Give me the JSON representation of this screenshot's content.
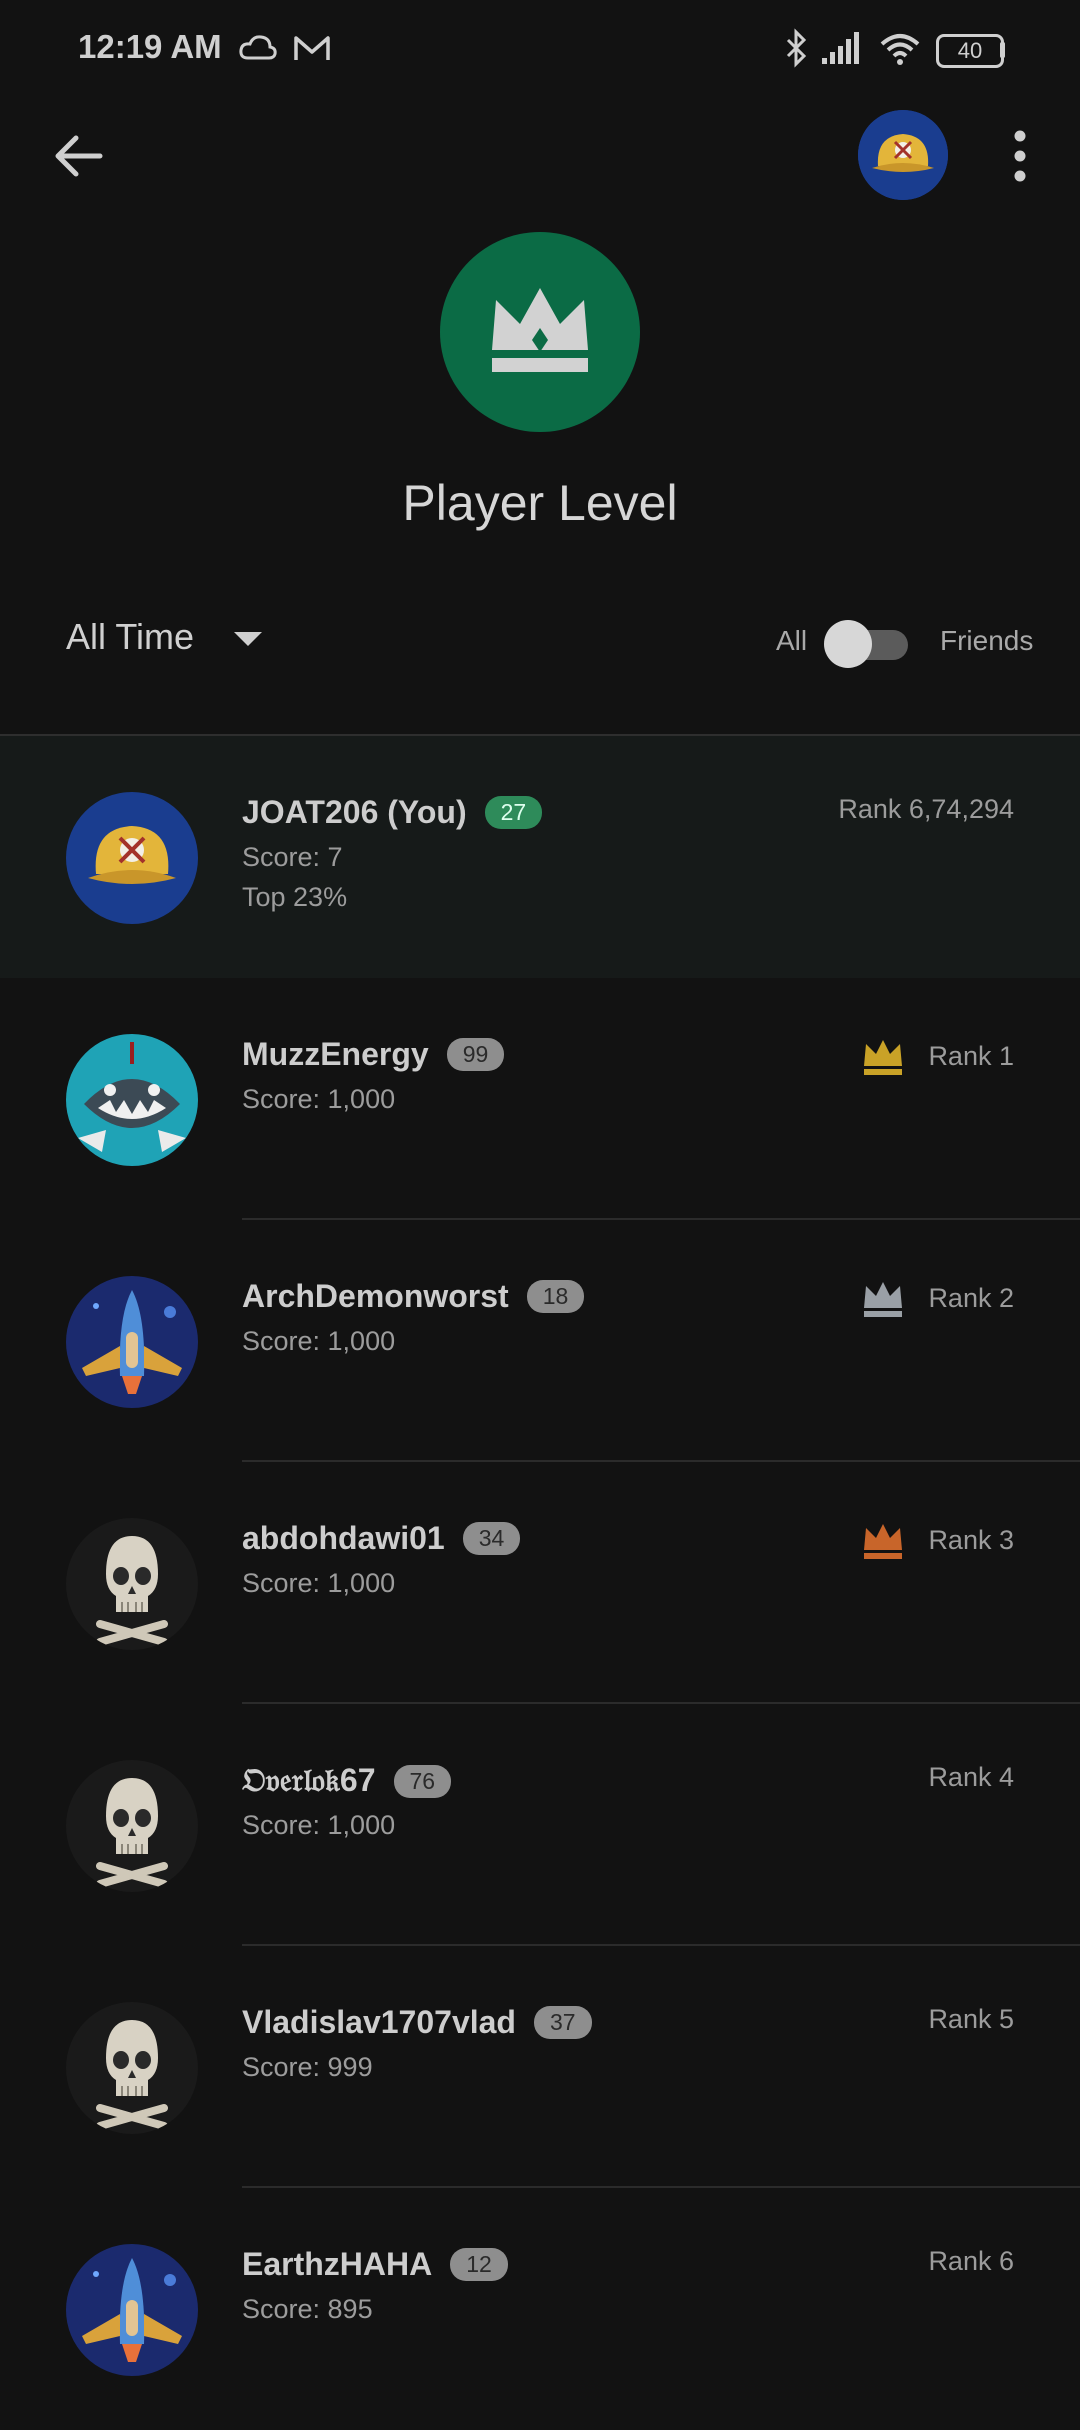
{
  "status_bar": {
    "time": "12:19 AM",
    "battery": "40"
  },
  "header": {
    "title": "Player Level"
  },
  "filters": {
    "time_range": "All Time",
    "toggle_left": "All",
    "toggle_right": "Friends"
  },
  "colors": {
    "background": "#121212",
    "accent_green": "#0b6b45",
    "gold": "#c9a227",
    "silver": "#9aa0a6",
    "bronze": "#c8652a"
  },
  "players": [
    {
      "name": "JOAT206 (You)",
      "level": "27",
      "score": "Score: 7",
      "top": "Top 23%",
      "rank": "Rank 6,74,294",
      "avatar": "baseball-cap",
      "crown": ""
    },
    {
      "name": "MuzzEnergy",
      "level": "99",
      "score": "Score: 1,000",
      "top": "",
      "rank": "Rank 1",
      "avatar": "shark",
      "crown": "gold"
    },
    {
      "name": "ArchDemonworst",
      "level": "18",
      "score": "Score: 1,000",
      "top": "",
      "rank": "Rank 2",
      "avatar": "spaceship",
      "crown": "silver"
    },
    {
      "name": "abdohdawi01",
      "level": "34",
      "score": "Score: 1,000",
      "top": "",
      "rank": "Rank 3",
      "avatar": "skull",
      "crown": "bronze"
    },
    {
      "name": "𝔒𝔳𝔢𝔯𝔩𝔬𝔨67",
      "level": "76",
      "score": "Score: 1,000",
      "top": "",
      "rank": "Rank 4",
      "avatar": "skull",
      "crown": ""
    },
    {
      "name": "Vladislav1707vlad",
      "level": "37",
      "score": "Score: 999",
      "top": "",
      "rank": "Rank 5",
      "avatar": "skull",
      "crown": ""
    },
    {
      "name": "EarthzHAHA",
      "level": "12",
      "score": "Score: 895",
      "top": "",
      "rank": "Rank 6",
      "avatar": "spaceship",
      "crown": ""
    }
  ]
}
